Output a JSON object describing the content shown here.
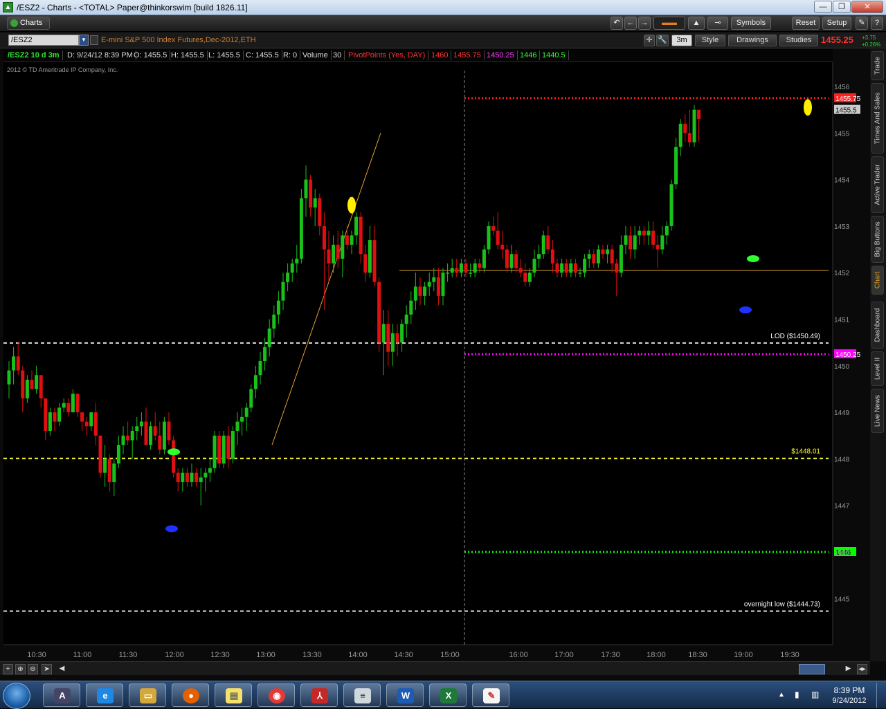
{
  "window": {
    "title": "/ESZ2 - Charts - <TOTAL> Paper@thinkorswim [build 1826.11]",
    "icon": "tos-icon"
  },
  "toolbar": {
    "charts_tab": "Charts",
    "symbols": "Symbols",
    "reset": "Reset",
    "setup": "Setup"
  },
  "chartbar": {
    "symbol": "/ESZ2",
    "description": "E-mini S&P 500 Index Futures,Dec-2012,ETH",
    "timeframe": "3m",
    "style": "Style",
    "drawings": "Drawings",
    "studies": "Studies",
    "last_price": "1455.25",
    "change_abs": "+3.75",
    "change_pct": "+0.26%"
  },
  "infobar": {
    "sym_period": "/ESZ2 10 d 3m",
    "date": "D: 9/24/12 8:39 PM",
    "open": "O: 1455.5",
    "high": "H: 1455.5",
    "low": "L: 1455.5",
    "close": "C: 1455.5",
    "range": "R: 0",
    "volume_label": "Volume",
    "volume": "30",
    "pivot_label": "PivotPoints (Yes, DAY)",
    "pivot_r": "1460",
    "pivot_r1": "1455.75",
    "pivot_pp": "1450.25",
    "pivot_s1": "1446",
    "pivot_s2": "1440.5"
  },
  "copyright": "2012 © TD Ameritrade IP Company, Inc.",
  "colors": {
    "up": "#19c219",
    "down": "#e01010",
    "pivot_r1": "#ff2020",
    "pivot_pp": "#ff00ff",
    "pivot_s1": "#00ff00",
    "level_yellow": "#ffff30",
    "trend": "#e0a030"
  },
  "chart_data": {
    "type": "candlestick",
    "y_ticks": [
      "1456",
      "1455",
      "1454",
      "1453",
      "1452",
      "1451",
      "1450",
      "1449",
      "1448",
      "1447",
      "1446",
      "1445"
    ],
    "x_ticks": [
      "10:30",
      "11:00",
      "11:30",
      "12:00",
      "12:30",
      "13:00",
      "13:30",
      "14:00",
      "14:30",
      "15:00",
      "16:00",
      "17:00",
      "17:30",
      "18:00",
      "18:30",
      "19:00",
      "19:30"
    ],
    "ylim": [
      1444.5,
      1456.6
    ],
    "levels": [
      {
        "label": "LOD ($1450.49)",
        "value": 1450.49,
        "style": "white-dashed"
      },
      {
        "label": "$1448.01",
        "value": 1448.01,
        "style": "yellow-dashed"
      },
      {
        "label": "overnight low ($1444.73)",
        "value": 1444.73,
        "style": "white-dashed"
      },
      {
        "label": "1455.75",
        "value": 1455.75,
        "style": "red-dotted"
      },
      {
        "label": "1450.25",
        "value": 1450.25,
        "style": "magenta-dotted"
      },
      {
        "label": "1446",
        "value": 1446,
        "style": "green-dotted"
      }
    ],
    "price_badge": "1455.5"
  },
  "sidebar": {
    "tabs": [
      "Trade",
      "Times And Sales",
      "Active Trader",
      "Big Buttons",
      "Chart",
      "Dashboard",
      "Level II",
      "Live News"
    ]
  },
  "taskbar": {
    "time": "8:39 PM",
    "date": "9/24/2012"
  }
}
